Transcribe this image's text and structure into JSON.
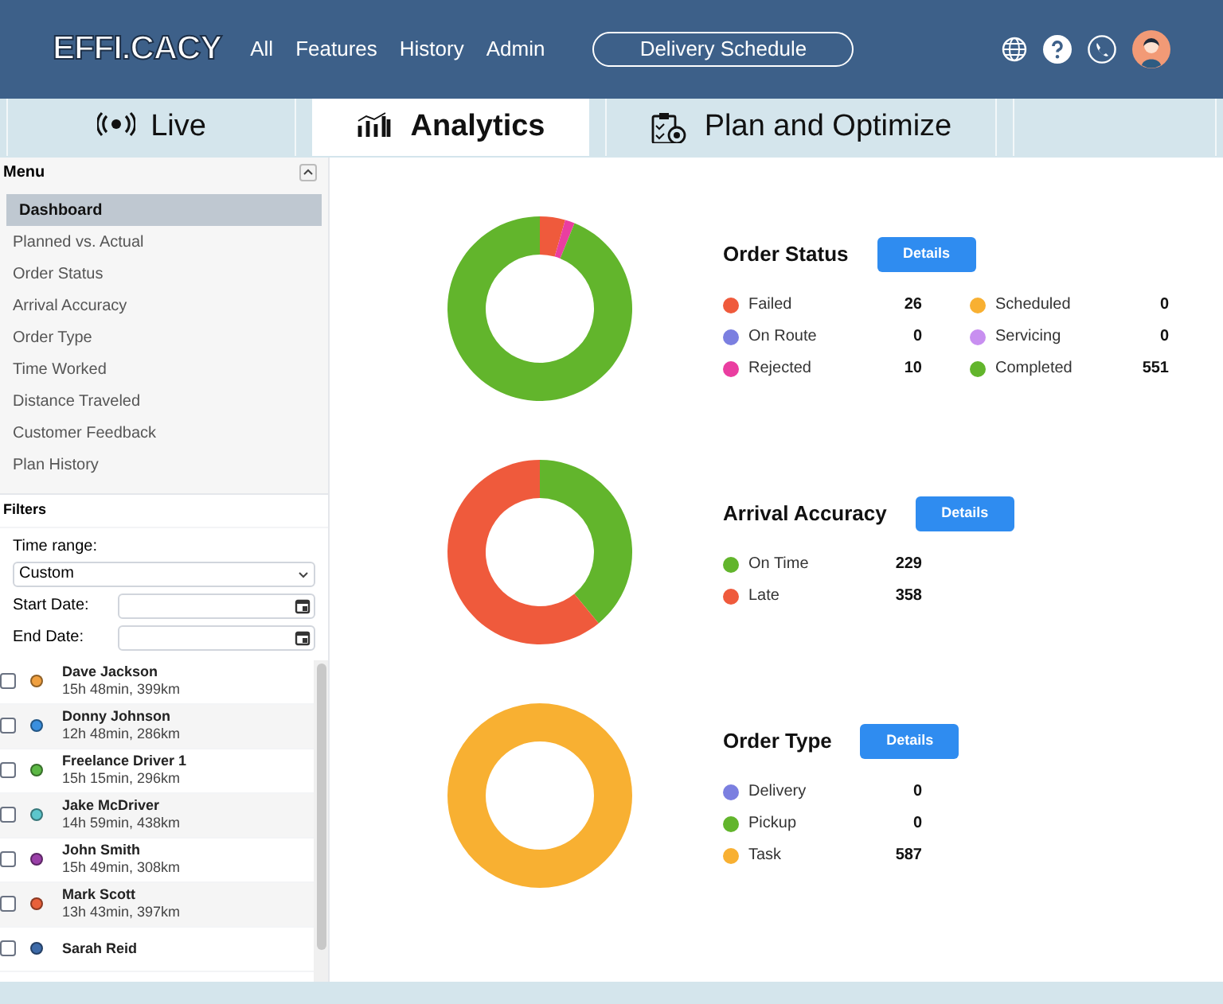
{
  "header": {
    "logo": "EFFI.CACY",
    "nav": [
      "All",
      "Features",
      "History",
      "Admin"
    ],
    "schedule_button": "Delivery Schedule"
  },
  "tabs": [
    {
      "label": "Live",
      "selected": false
    },
    {
      "label": "Analytics",
      "selected": true
    },
    {
      "label": "Plan and Optimize",
      "selected": false
    }
  ],
  "sidebar": {
    "menu_title": "Menu",
    "menu": [
      {
        "label": "Dashboard",
        "selected": true
      },
      {
        "label": "Planned vs. Actual",
        "selected": false
      },
      {
        "label": "Order Status",
        "selected": false
      },
      {
        "label": "Arrival Accuracy",
        "selected": false
      },
      {
        "label": "Order Type",
        "selected": false
      },
      {
        "label": "Time Worked",
        "selected": false
      },
      {
        "label": "Distance Traveled",
        "selected": false
      },
      {
        "label": "Customer Feedback",
        "selected": false
      },
      {
        "label": "Plan History",
        "selected": false
      }
    ],
    "filters_title": "Filters",
    "time_range_label": "Time range:",
    "time_range_value": "Custom",
    "start_label": "Start Date:",
    "end_label": "End Date:",
    "drivers": [
      {
        "name": "Dave Jackson",
        "detail": "15h 48min, 399km",
        "color": "#f0a040",
        "checked": false
      },
      {
        "name": "Donny Johnson",
        "detail": "12h 48min, 286km",
        "color": "#3a8fde",
        "checked": false
      },
      {
        "name": "Freelance Driver 1",
        "detail": "15h 15min, 296km",
        "color": "#5cb845",
        "checked": false
      },
      {
        "name": "Jake McDriver",
        "detail": "14h 59min, 438km",
        "color": "#5cc6cc",
        "checked": false
      },
      {
        "name": "John Smith",
        "detail": "15h 49min, 308km",
        "color": "#9a3fa8",
        "checked": false
      },
      {
        "name": "Mark Scott",
        "detail": "13h 43min, 397km",
        "color": "#e8603a",
        "checked": false
      },
      {
        "name": "Sarah Reid",
        "color": "#3d6aa8",
        "checked": false
      }
    ]
  },
  "panels": [
    {
      "title": "Order Status",
      "button": "Details",
      "legend": [
        {
          "label": "Failed",
          "value": "26",
          "color": "#ef5a3c"
        },
        {
          "label": "On Route",
          "value": "0",
          "color": "#7b7fe0"
        },
        {
          "label": "Rejected",
          "value": "10",
          "color": "#ea3ea0"
        },
        {
          "label": "Scheduled",
          "value": "0",
          "color": "#f8b032"
        },
        {
          "label": "Servicing",
          "value": "0",
          "color": "#c88ff0"
        },
        {
          "label": "Completed",
          "value": "551",
          "color": "#62b52c"
        }
      ]
    },
    {
      "title": "Arrival Accuracy",
      "button": "Details",
      "legend": [
        {
          "label": "On Time",
          "value": "229",
          "color": "#62b52c"
        },
        {
          "label": "Late",
          "value": "358",
          "color": "#ef5a3c"
        }
      ]
    },
    {
      "title": "Order Type",
      "button": "Details",
      "legend": [
        {
          "label": "Delivery",
          "value": "0",
          "color": "#7b7fe0"
        },
        {
          "label": "Pickup",
          "value": "0",
          "color": "#62b52c"
        },
        {
          "label": "Task",
          "value": "587",
          "color": "#f8b032"
        }
      ]
    }
  ]
}
